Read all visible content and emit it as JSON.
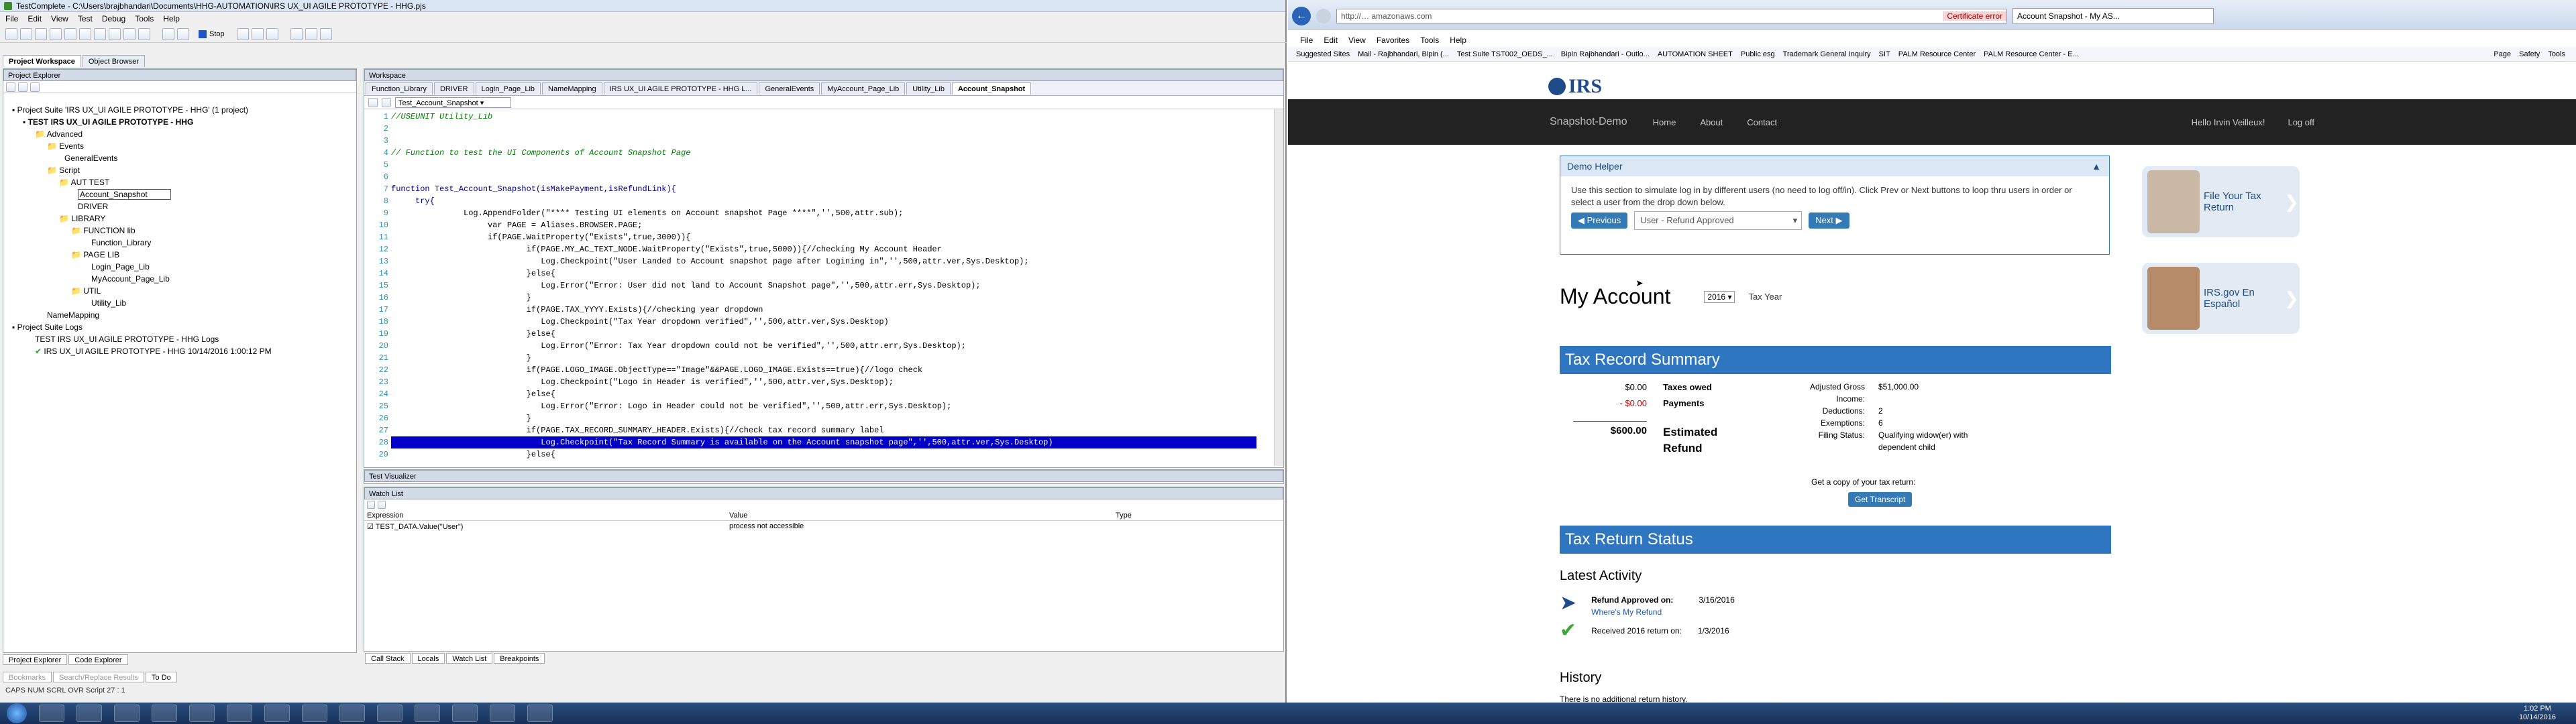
{
  "testcomplete": {
    "title": "TestComplete - C:\\Users\\brajbhandari\\Documents\\HHG-AUTOMATION\\IRS UX_UI AGILE PROTOTYPE - HHG.pjs",
    "menu": [
      "File",
      "Edit",
      "View",
      "Test",
      "Debug",
      "Tools",
      "Help"
    ],
    "stop_label": "Stop",
    "left_tabs": [
      "Project Workspace",
      "Object Browser"
    ],
    "project_explorer_title": "Project Explorer",
    "workspace_title": "Workspace",
    "workspace_tabs": [
      "Function_Library",
      "DRIVER",
      "Login_Page_Lib",
      "NameMapping",
      "IRS UX_UI AGILE PROTOTYPE - HHG L...",
      "GeneralEvents",
      "MyAccount_Page_Lib",
      "Utility_Lib",
      "Account_Snapshot"
    ],
    "editor_tab": "Test_Account_Snapshot",
    "tree": [
      "Project Suite 'IRS UX_UI AGILE PROTOTYPE - HHG' (1 project)",
      "TEST IRS UX_UI AGILE PROTOTYPE - HHG",
      "Advanced",
      "Events",
      "GeneralEvents",
      "Script",
      "AUT TEST",
      "Account_Snapshot",
      "DRIVER",
      "LIBRARY",
      "FUNCTION lib",
      "Function_Library",
      "PAGE LIB",
      "Login_Page_Lib",
      "MyAccount_Page_Lib",
      "UTIL",
      "Utility_Lib",
      "NameMapping",
      "Project Suite Logs",
      "TEST IRS UX_UI AGILE PROTOTYPE - HHG Logs",
      "IRS UX_UI AGILE PROTOTYPE - HHG 10/14/2016 1:00:12 PM"
    ],
    "code_lines": [
      {
        "n": "1",
        "t": "//USEUNIT Utility_Lib",
        "c": "cmt"
      },
      {
        "n": "2",
        "t": "",
        "c": ""
      },
      {
        "n": "3",
        "t": "",
        "c": ""
      },
      {
        "n": "4",
        "t": "// Function to test the UI Components of Account Snapshot Page",
        "c": "cmt"
      },
      {
        "n": "5",
        "t": "",
        "c": ""
      },
      {
        "n": "6",
        "t": "",
        "c": ""
      },
      {
        "n": "7",
        "t": "function Test_Account_Snapshot(isMakePayment,isRefundLink){",
        "c": "kw"
      },
      {
        "n": "8",
        "t": "     try{",
        "c": "kw"
      },
      {
        "n": "9",
        "t": "               Log.AppendFolder(\"**** Testing UI elements on Account snapshot Page ****\",'',500,attr.sub);",
        "c": ""
      },
      {
        "n": "10",
        "t": "                    var PAGE = Aliases.BROWSER.PAGE;",
        "c": ""
      },
      {
        "n": "11",
        "t": "                    if(PAGE.WaitProperty(\"Exists\",true,3000)){",
        "c": ""
      },
      {
        "n": "12",
        "t": "                            if(PAGE.MY_AC_TEXT_NODE.WaitProperty(\"Exists\",true,5000)){//checking My Account Header",
        "c": ""
      },
      {
        "n": "13",
        "t": "                               Log.Checkpoint(\"User Landed to Account snapshot page after Logining in\",'',500,attr.ver,Sys.Desktop);",
        "c": ""
      },
      {
        "n": "14",
        "t": "                            }else{",
        "c": ""
      },
      {
        "n": "15",
        "t": "                               Log.Error(\"Error: User did not land to Account Snapshot page\",'',500,attr.err,Sys.Desktop);",
        "c": ""
      },
      {
        "n": "16",
        "t": "                            }",
        "c": ""
      },
      {
        "n": "17",
        "t": "                            if(PAGE.TAX_YYYY.Exists){//checking year dropdown",
        "c": ""
      },
      {
        "n": "18",
        "t": "                               Log.Checkpoint(\"Tax Year dropdown verified\",'',500,attr.ver,Sys.Desktop)",
        "c": ""
      },
      {
        "n": "19",
        "t": "                            }else{",
        "c": ""
      },
      {
        "n": "20",
        "t": "                               Log.Error(\"Error: Tax Year dropdown could not be verified\",'',500,attr.err,Sys.Desktop);",
        "c": ""
      },
      {
        "n": "21",
        "t": "                            }",
        "c": ""
      },
      {
        "n": "22",
        "t": "                            if(PAGE.LOGO_IMAGE.ObjectType==\"Image\"&&PAGE.LOGO_IMAGE.Exists==true){//logo check",
        "c": ""
      },
      {
        "n": "23",
        "t": "                               Log.Checkpoint(\"Logo in Header is verified\",'',500,attr.ver,Sys.Desktop);",
        "c": ""
      },
      {
        "n": "24",
        "t": "                            }else{",
        "c": ""
      },
      {
        "n": "25",
        "t": "                               Log.Error(\"Error: Logo in Header could not be verified\",'',500,attr.err,Sys.Desktop);",
        "c": ""
      },
      {
        "n": "26",
        "t": "                            }",
        "c": ""
      },
      {
        "n": "27",
        "t": "                            if(PAGE.TAX_RECORD_SUMMARY_HEADER.Exists){//check tax record summary label",
        "c": ""
      },
      {
        "n": "28",
        "t": "                               Log.Checkpoint(\"Tax Record Summary is available on the Account snapshot page\",'',500,attr.ver,Sys.Desktop)",
        "c": "sel"
      },
      {
        "n": "29",
        "t": "                            }else{",
        "c": ""
      }
    ],
    "test_visualizer": "Test Visualizer",
    "watch_list": "Watch List",
    "watch_headers": [
      "Expression",
      "Value",
      "Type"
    ],
    "watch_row": {
      "expr": "TEST_DATA.Value(\"User\")",
      "value": "process not accessible",
      "type": ""
    },
    "bottom_tabs": [
      "Call Stack",
      "Locals",
      "Watch List",
      "Breakpoints"
    ],
    "left_bottom_tabs": [
      "Project Explorer",
      "Code Explorer"
    ],
    "left_bottom_tabs2": [
      "Bookmarks",
      "Search/Replace Results",
      "To Do"
    ],
    "status": "CAPS  NUM  SCRL  OVR  Script  27 : 1"
  },
  "ie": {
    "url": "http://… amazonaws.com",
    "cert": "Certificate error",
    "tab": "Account Snapshot - My AS...",
    "menu": [
      "File",
      "Edit",
      "View",
      "Favorites",
      "Tools",
      "Help"
    ],
    "favorites": [
      "Suggested Sites",
      "Mail - Rajbhandari, Bipin (...",
      "Test Suite TST002_OEDS_...",
      "Bipin Rajbhandari - Outlo...",
      "AUTOMATION SHEET",
      "Public esg",
      "Trademark General Inquiry",
      "SIT",
      "PALM Resource Center",
      "PALM Resource Center - E..."
    ],
    "cmd": [
      "Page",
      "Safety",
      "Tools"
    ]
  },
  "site": {
    "logo": "IRS",
    "brand": "Snapshot-Demo",
    "nav": [
      "Home",
      "About",
      "Contact"
    ],
    "greeting": "Hello Irvin Veilleux!",
    "logoff": "Log off",
    "demo_title": "Demo Helper",
    "demo_text": "Use this section to simulate log in by different users (no need to log off/in). Click Prev or Next buttons to loop thru users in order or select a user from the drop down below.",
    "prev": "Previous",
    "select": "User - Refund Approved",
    "next": "Next",
    "my_account": "My Account",
    "year": "2016",
    "tax_year": "Tax Year",
    "trs_header": "Tax Record Summary",
    "taxes_owed_amt": "$0.00",
    "taxes_owed": "Taxes owed",
    "payments_amt": "- $0.00",
    "payments": "Payments",
    "refund_amt": "$600.00",
    "estimated_refund": "Estimated Refund",
    "summary": [
      {
        "k": "Adjusted Gross Income:",
        "v": "$51,000.00"
      },
      {
        "k": "Deductions:",
        "v": "2"
      },
      {
        "k": "Exemptions:",
        "v": "6"
      },
      {
        "k": "Filing Status:",
        "v": "Qualifying widow(er) with dependent child"
      }
    ],
    "copy_text": "Get a copy of your tax return:",
    "get_transcript": "Get Transcript",
    "trs2_header": "Tax Return Status",
    "latest_activity": "Latest Activity",
    "refund_approved": "Refund Approved on:",
    "refund_date": "3/16/2016",
    "wheres_refund": "Where's My Refund",
    "received": "Received 2016 return on:",
    "received_date": "1/3/2016",
    "history": "History",
    "no_history": "There is no additional return history.",
    "ad1": "File Your Tax Return",
    "ad2": "IRS.gov En Español"
  },
  "taskbar": {
    "time": "1:02 PM",
    "date": "10/14/2016"
  }
}
